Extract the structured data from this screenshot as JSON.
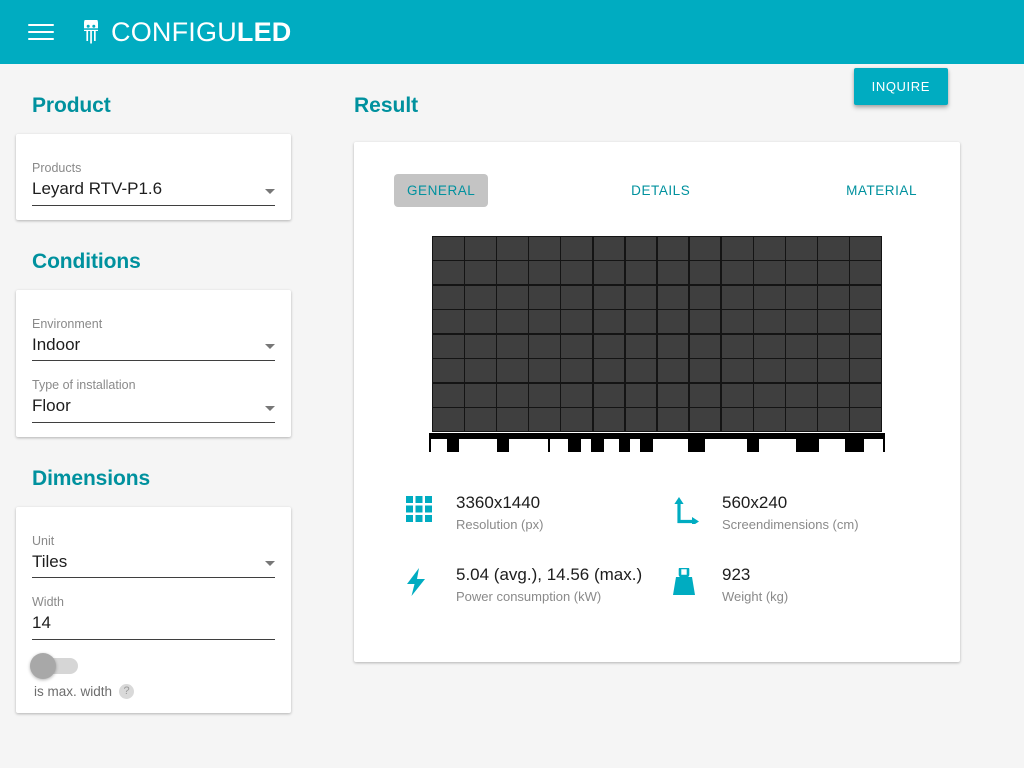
{
  "appbar": {
    "menu_icon": "hamburger-menu-icon",
    "logo_icon": "led-diode-icon",
    "brand_light": "CONFIGU",
    "brand_bold": "LED",
    "background_color": "#00ACC1"
  },
  "sidebar": {
    "sections": [
      {
        "title": "Product",
        "fields": [
          {
            "label": "Products",
            "value": "Leyard RTV-P1.6",
            "type": "select"
          }
        ]
      },
      {
        "title": "Conditions",
        "fields": [
          {
            "label": "Environment",
            "value": "Indoor",
            "type": "select"
          },
          {
            "label": "Type of installation",
            "value": "Floor",
            "type": "select"
          }
        ]
      },
      {
        "title": "Dimensions",
        "fields": [
          {
            "label": "Unit",
            "value": "Tiles",
            "type": "select"
          },
          {
            "label": "Width",
            "value": "14",
            "type": "text"
          }
        ],
        "toggle": {
          "label": "is max. width",
          "state": "off",
          "help_icon": "help-circle-icon"
        }
      }
    ]
  },
  "result": {
    "title": "Result",
    "inquire_label": "INQUIRE",
    "accent_color": "#00ACC1",
    "heading_color": "#00919e",
    "tabs": [
      {
        "label": "GENERAL",
        "active": true
      },
      {
        "label": "DETAILS",
        "active": false
      },
      {
        "label": "MATERIAL",
        "active": false
      }
    ],
    "preview": {
      "name": "led-wall-preview",
      "tile_columns": 14,
      "tile_rows": 8,
      "tile_color": "#3f3f3f",
      "frame_color": "#141414",
      "base_color": "#000000"
    },
    "stats": [
      {
        "icon": "grid-resolution-icon",
        "value": "3360x1440",
        "label": "Resolution (px)"
      },
      {
        "icon": "dimensions-arrow-icon",
        "value": "560x240",
        "label": "Screendimensions (cm)"
      },
      {
        "icon": "power-bolt-icon",
        "value": "5.04 (avg.), 14.56 (max.)",
        "label": "Power consumption (kW)"
      },
      {
        "icon": "weight-icon",
        "value": "923",
        "label": "Weight (kg)"
      }
    ]
  }
}
